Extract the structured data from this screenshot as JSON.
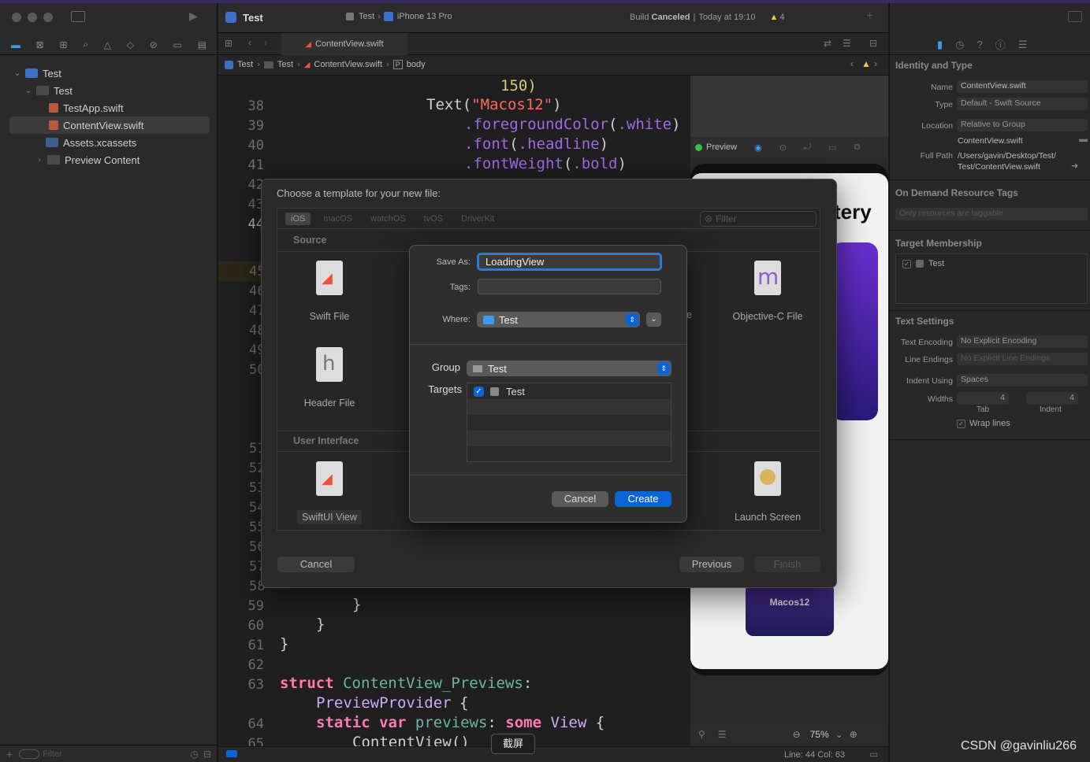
{
  "toolbar": {
    "scheme": "Test",
    "target_app": "Test",
    "destination": "iPhone 13 Pro",
    "build_status_prefix": "Build",
    "build_status": "Canceled",
    "build_time": "Today at 19:10",
    "warning_count": "4"
  },
  "navigator": {
    "items": [
      {
        "label": "Test"
      },
      {
        "label": "Test"
      },
      {
        "label": "TestApp.swift"
      },
      {
        "label": "ContentView.swift"
      },
      {
        "label": "Assets.xcassets"
      },
      {
        "label": "Preview Content"
      }
    ],
    "filter_placeholder": "Filter"
  },
  "editor": {
    "tab": "ContentView.swift",
    "breadcrumb": [
      "Test",
      "Test",
      "ContentView.swift",
      "body"
    ],
    "line_numbers_top": [
      "38",
      "39",
      "40",
      "41",
      "42",
      "43",
      "44"
    ],
    "line_numbers_left": [
      "45",
      "46",
      "47",
      "48",
      "49",
      "50",
      "51",
      "52",
      "53",
      "54",
      "55",
      "56",
      "57",
      "58"
    ],
    "line_numbers_bottom": [
      "59",
      "60",
      "61",
      "62",
      "63",
      "64",
      "65"
    ],
    "code": {
      "l37": "150)",
      "l38_fn": "Text",
      "l38_str": "\"Macos12\"",
      "l39_a": ".foregroundColor",
      "l39_b": ".white",
      "l40_a": ".font",
      "l40_b": ".headline",
      "l41_a": ".fontWeight",
      "l41_b": ".bold",
      "l59": "}",
      "l60": "}",
      "l61": "}",
      "l63_kw": "struct",
      "l63_ty": "ContentView_Previews",
      "l63b": "PreviewProvider",
      "l64_kw1": "static",
      "l64_kw2": "var",
      "l64_name": "previews",
      "l64_kw3": "some",
      "l64_ty": "View",
      "l65": "ContentView()"
    },
    "status_position": "Line: 44  Col: 63"
  },
  "preview": {
    "label": "Preview",
    "card_text": "tery",
    "tile_label": "Macos12",
    "zoom": "75%"
  },
  "inspector": {
    "identity_title": "Identity and Type",
    "name_label": "Name",
    "name_value": "ContentView.swift",
    "type_label": "Type",
    "type_value": "Default - Swift Source",
    "location_label": "Location",
    "location_value": "Relative to Group",
    "location_file": "ContentView.swift",
    "fullpath_label": "Full Path",
    "fullpath_value_1": "/Users/gavin/Desktop/Test/",
    "fullpath_value_2": "Test/ContentView.swift",
    "odr_title": "On Demand Resource Tags",
    "odr_placeholder": "Only resources are taggable",
    "membership_title": "Target Membership",
    "membership_target": "Test",
    "text_settings_title": "Text Settings",
    "encoding_label": "Text Encoding",
    "encoding_value": "No Explicit Encoding",
    "line_endings_label": "Line Endings",
    "line_endings_value": "No Explicit Line Endings",
    "indent_label": "Indent Using",
    "indent_value": "Spaces",
    "widths_label": "Widths",
    "tab_width": "4",
    "indent_width": "4",
    "tab_caption": "Tab",
    "indent_caption": "Indent",
    "wrap_lines": "Wrap lines"
  },
  "template_sheet": {
    "title": "Choose a template for your new file:",
    "platforms": [
      "iOS",
      "macOS",
      "watchOS",
      "tvOS",
      "DriverKit"
    ],
    "filter_placeholder": "Filter",
    "section_source": "Source",
    "section_ui": "User Interface",
    "templates": {
      "swift_file": "Swift File",
      "header_file": "Header File",
      "objc_file": "Objective-C File",
      "swiftui_view": "SwiftUI View",
      "launch_screen": "Launch Screen",
      "partial_e": "e"
    },
    "cancel": "Cancel",
    "previous": "Previous",
    "finish": "Finish"
  },
  "save_dialog": {
    "save_as_label": "Save As:",
    "save_as_value": "LoadingView",
    "tags_label": "Tags:",
    "where_label": "Where:",
    "where_value": "Test",
    "group_label": "Group",
    "group_value": "Test",
    "targets_label": "Targets",
    "target_name": "Test",
    "cancel": "Cancel",
    "create": "Create"
  },
  "tooltip": "截屏",
  "watermark": "CSDN @gavinliu266",
  "colors": {
    "accent": "#0a64d8",
    "warning": "#f5c242",
    "swift_orange": "#f05138",
    "folder_blue": "#3b9bf5",
    "preview_purple": "#6a2fd0"
  }
}
